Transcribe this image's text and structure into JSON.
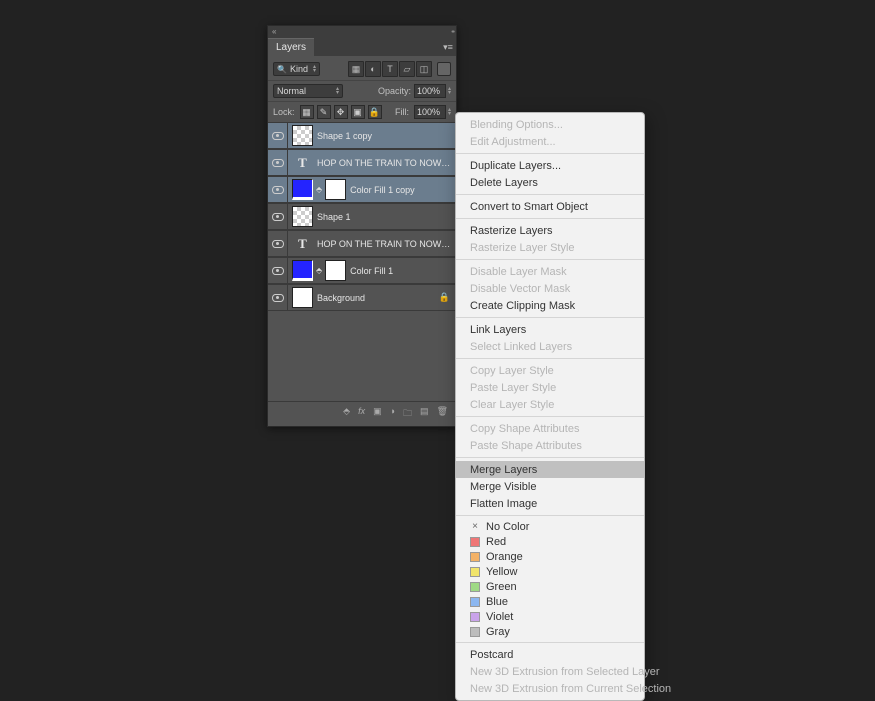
{
  "panel": {
    "title": "Layers",
    "filter": {
      "kind_label": "Kind",
      "kind_icon": "🔍"
    },
    "blend": {
      "mode": "Normal",
      "opacity_label": "Opacity:",
      "opacity_value": "100%"
    },
    "lock": {
      "label": "Lock:",
      "fill_label": "Fill:",
      "fill_value": "100%"
    },
    "layers": [
      {
        "name": "Shape 1 copy",
        "type": "shape",
        "selected": true
      },
      {
        "name": "HOP ON THE TRAIN TO NOWHERE BAB...",
        "type": "text",
        "selected": true
      },
      {
        "name": "Color Fill 1 copy",
        "type": "fill",
        "selected": true
      },
      {
        "name": "Shape 1",
        "type": "shape",
        "selected": false
      },
      {
        "name": "HOP ON THE TRAIN TO NOWHERE BABY",
        "type": "text",
        "selected": false
      },
      {
        "name": "Color Fill 1",
        "type": "fill",
        "selected": false
      },
      {
        "name": "Background",
        "type": "bg",
        "selected": false,
        "locked": true
      }
    ]
  },
  "menu": {
    "items": [
      {
        "label": "Blending Options...",
        "disabled": true
      },
      {
        "label": "Edit Adjustment...",
        "disabled": true
      },
      {
        "sep": true
      },
      {
        "label": "Duplicate Layers..."
      },
      {
        "label": "Delete Layers"
      },
      {
        "sep": true
      },
      {
        "label": "Convert to Smart Object"
      },
      {
        "sep": true
      },
      {
        "label": "Rasterize Layers"
      },
      {
        "label": "Rasterize Layer Style",
        "disabled": true
      },
      {
        "sep": true
      },
      {
        "label": "Disable Layer Mask",
        "disabled": true
      },
      {
        "label": "Disable Vector Mask",
        "disabled": true
      },
      {
        "label": "Create Clipping Mask"
      },
      {
        "sep": true
      },
      {
        "label": "Link Layers"
      },
      {
        "label": "Select Linked Layers",
        "disabled": true
      },
      {
        "sep": true
      },
      {
        "label": "Copy Layer Style",
        "disabled": true
      },
      {
        "label": "Paste Layer Style",
        "disabled": true
      },
      {
        "label": "Clear Layer Style",
        "disabled": true
      },
      {
        "sep": true
      },
      {
        "label": "Copy Shape Attributes",
        "disabled": true
      },
      {
        "label": "Paste Shape Attributes",
        "disabled": true
      },
      {
        "sep": true
      },
      {
        "label": "Merge Layers",
        "highlight": true
      },
      {
        "label": "Merge Visible"
      },
      {
        "label": "Flatten Image"
      },
      {
        "sep": true
      },
      {
        "color": "none",
        "label": "No Color"
      },
      {
        "color": "#ef7676",
        "label": "Red"
      },
      {
        "color": "#f3b268",
        "label": "Orange"
      },
      {
        "color": "#f1e46b",
        "label": "Yellow"
      },
      {
        "color": "#9fd985",
        "label": "Green"
      },
      {
        "color": "#8cb7f0",
        "label": "Blue"
      },
      {
        "color": "#c9a3ea",
        "label": "Violet"
      },
      {
        "color": "#bcbcbc",
        "label": "Gray"
      },
      {
        "sep": true
      },
      {
        "label": "Postcard"
      },
      {
        "label": "New 3D Extrusion from Selected Layer",
        "disabled": true
      },
      {
        "label": "New 3D Extrusion from Current Selection",
        "disabled": true
      }
    ]
  }
}
